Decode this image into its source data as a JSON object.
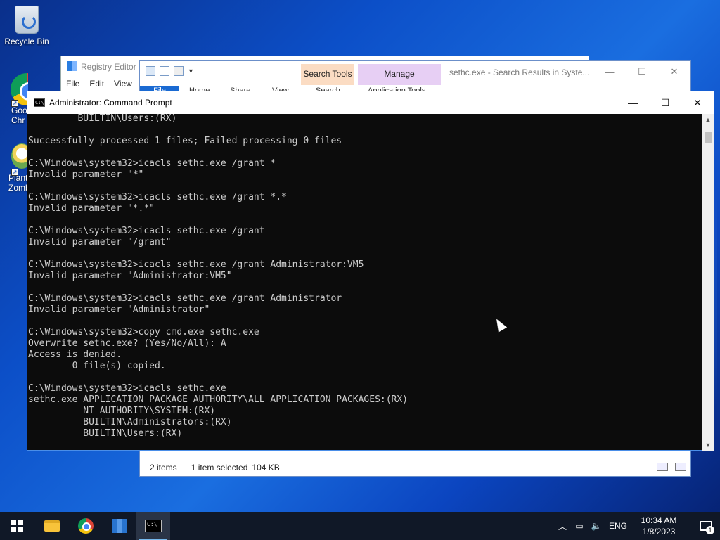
{
  "desktop": {
    "icons": [
      {
        "label": "Recycle Bin"
      },
      {
        "label": "Goo\nChr"
      },
      {
        "label": "Plant\nZombi"
      }
    ]
  },
  "registry_editor": {
    "title": "Registry Editor",
    "menu": [
      "File",
      "Edit",
      "View"
    ]
  },
  "explorer": {
    "title": "sethc.exe - Search Results in Syste...",
    "context_tabs": {
      "search": "Search Tools",
      "manage": "Manage"
    },
    "ribbon_tabs": [
      "File",
      "Home",
      "Share",
      "View",
      "Search",
      "Application Tools"
    ],
    "status": {
      "items": "2 items",
      "selected": "1 item selected",
      "size": "104 KB"
    }
  },
  "cmd": {
    "title": "Administrator: Command Prompt",
    "lines": [
      "         BUILTIN\\Users:(RX)",
      "",
      "Successfully processed 1 files; Failed processing 0 files",
      "",
      "C:\\Windows\\system32>icacls sethc.exe /grant *",
      "Invalid parameter \"*\"",
      "",
      "C:\\Windows\\system32>icacls sethc.exe /grant *.*",
      "Invalid parameter \"*.*\"",
      "",
      "C:\\Windows\\system32>icacls sethc.exe /grant",
      "Invalid parameter \"/grant\"",
      "",
      "C:\\Windows\\system32>icacls sethc.exe /grant Administrator:VM5",
      "Invalid parameter \"Administrator:VM5\"",
      "",
      "C:\\Windows\\system32>icacls sethc.exe /grant Administrator",
      "Invalid parameter \"Administrator\"",
      "",
      "C:\\Windows\\system32>copy cmd.exe sethc.exe",
      "Overwrite sethc.exe? (Yes/No/All): A",
      "Access is denied.",
      "        0 file(s) copied.",
      "",
      "C:\\Windows\\system32>icacls sethc.exe",
      "sethc.exe APPLICATION PACKAGE AUTHORITY\\ALL APPLICATION PACKAGES:(RX)",
      "          NT AUTHORITY\\SYSTEM:(RX)",
      "          BUILTIN\\Administrators:(RX)",
      "          BUILTIN\\Users:(RX)"
    ]
  },
  "taskbar": {
    "language": "ENG",
    "time": "10:34 AM",
    "date": "1/8/2023",
    "notification_count": "1"
  }
}
